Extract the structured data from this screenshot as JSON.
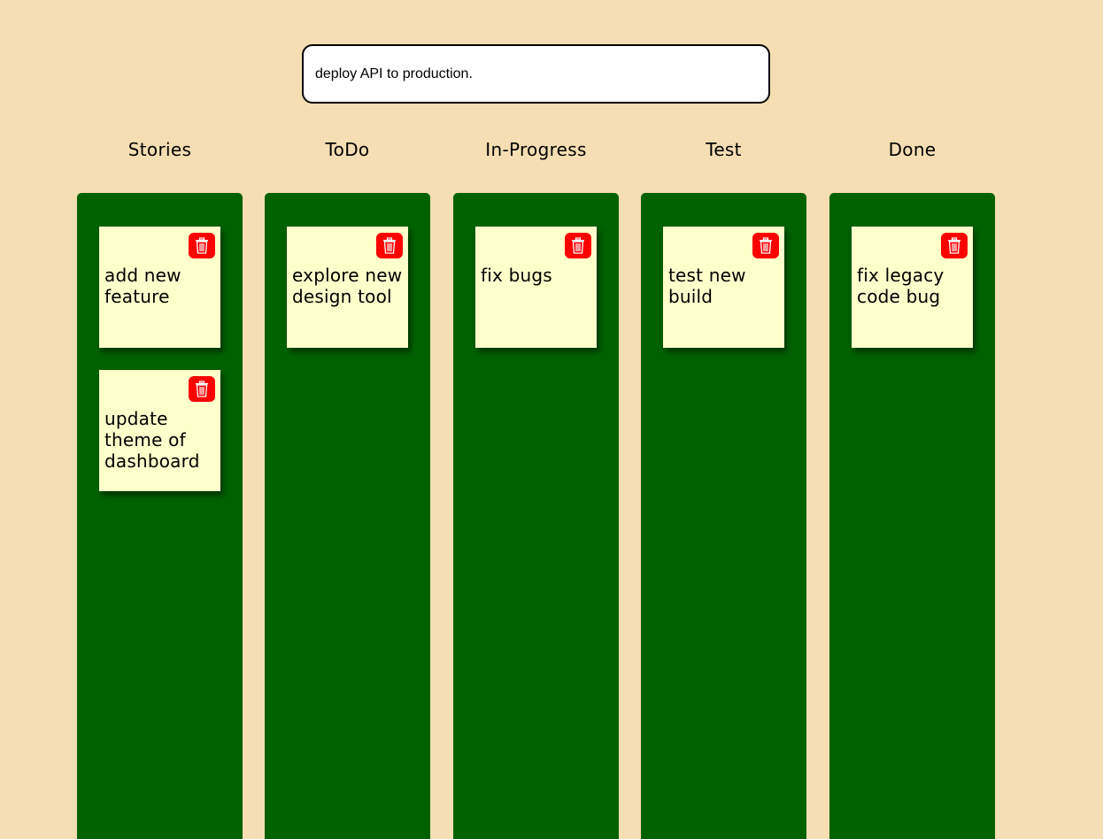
{
  "input": {
    "value": "deploy API to production."
  },
  "columns": [
    {
      "title": "Stories",
      "cards": [
        {
          "text": "add new feature",
          "delete_icon": "trash-icon"
        },
        {
          "text": "update theme of dashboard",
          "delete_icon": "trash-icon"
        }
      ]
    },
    {
      "title": "ToDo",
      "cards": [
        {
          "text": "explore new design tool",
          "delete_icon": "trash-icon"
        }
      ]
    },
    {
      "title": "In-Progress",
      "cards": [
        {
          "text": "fix bugs",
          "delete_icon": "trash-icon"
        }
      ]
    },
    {
      "title": "Test",
      "cards": [
        {
          "text": "test new build",
          "delete_icon": "trash-icon"
        }
      ]
    },
    {
      "title": "Done",
      "cards": [
        {
          "text": "fix legacy code bug",
          "delete_icon": "trash-icon"
        }
      ]
    }
  ],
  "colors": {
    "background": "#f5deb3",
    "lane": "#006100",
    "card": "#ffffcc",
    "delete_button": "#ff0000"
  }
}
